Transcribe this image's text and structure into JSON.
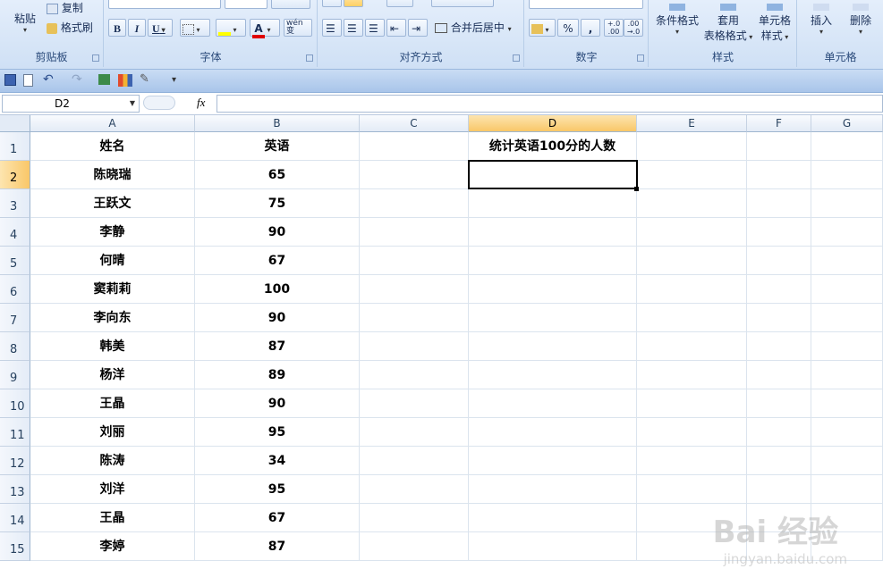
{
  "ribbon": {
    "clipboard": {
      "paste": "粘贴",
      "copy": "复制",
      "format_painter": "格式刷",
      "group": "剪贴板"
    },
    "font": {
      "bold": "B",
      "italic": "I",
      "underline": "U",
      "font_color": "A",
      "phonetic": "wén\n变",
      "group": "字体"
    },
    "alignment": {
      "merge_center": "合并后居中",
      "group": "对齐方式"
    },
    "number": {
      "percent": "%",
      "comma": ",",
      "increase_decimal": "+.0\n.00",
      "decrease_decimal": ".00\n→.0",
      "group": "数字"
    },
    "styles": {
      "conditional": "条件格式",
      "table_format_1": "套用",
      "table_format_2": "表格格式",
      "cell_styles_1": "单元格",
      "cell_styles_2": "样式",
      "group": "样式"
    },
    "cells": {
      "insert": "插入",
      "delete": "删除",
      "group": "单元格"
    }
  },
  "formula_bar": {
    "name_box": "D2",
    "fx": "fx",
    "formula": ""
  },
  "columns": [
    "A",
    "B",
    "C",
    "D",
    "E",
    "F",
    "G"
  ],
  "header_row": {
    "name": "姓名",
    "english": "英语",
    "stat_label": "统计英语100分的人数"
  },
  "rows": [
    {
      "num": "1",
      "name": "",
      "score": ""
    },
    {
      "num": "2",
      "name": "陈晓瑞",
      "score": "65"
    },
    {
      "num": "3",
      "name": "王跃文",
      "score": "75"
    },
    {
      "num": "4",
      "name": "李静",
      "score": "90"
    },
    {
      "num": "5",
      "name": "何晴",
      "score": "67"
    },
    {
      "num": "6",
      "name": "窦莉莉",
      "score": "100"
    },
    {
      "num": "7",
      "name": "李向东",
      "score": "90"
    },
    {
      "num": "8",
      "name": "韩美",
      "score": "87"
    },
    {
      "num": "9",
      "name": "杨洋",
      "score": "89"
    },
    {
      "num": "10",
      "name": "王晶",
      "score": "90"
    },
    {
      "num": "11",
      "name": "刘丽",
      "score": "95"
    },
    {
      "num": "12",
      "name": "陈涛",
      "score": "34"
    },
    {
      "num": "13",
      "name": "刘洋",
      "score": "95"
    },
    {
      "num": "14",
      "name": "王晶",
      "score": "67"
    },
    {
      "num": "15",
      "name": "李婷",
      "score": "87"
    }
  ],
  "watermark": {
    "main": "Bai 经验",
    "sub": "jingyan.baidu.com"
  }
}
